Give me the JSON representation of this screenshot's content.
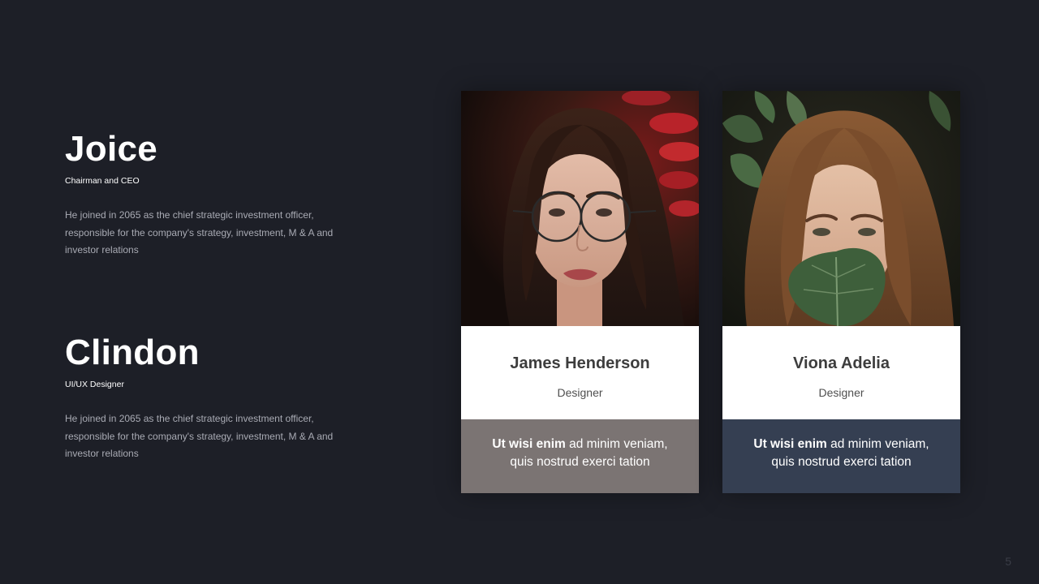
{
  "executives": [
    {
      "name": "Joice",
      "role": "Chairman and CEO",
      "bio": "He joined in 2065 as the chief strategic investment officer, responsible for the company's strategy, investment, M & A and investor relations"
    },
    {
      "name": "Clindon",
      "role": "UI/UX Designer",
      "bio": "He joined in 2065 as the chief strategic investment officer, responsible for the company's strategy, investment, M & A and investor relations"
    }
  ],
  "team": [
    {
      "name": "James Henderson",
      "role": "Designer",
      "quote_bold": "Ut wisi enim",
      "quote_rest": " ad minim veniam,",
      "quote_line2": "quis nostrud exerci tation",
      "accent": "#7b7473"
    },
    {
      "name": "Viona Adelia",
      "role": "Designer",
      "quote_bold": "Ut wisi enim",
      "quote_rest": " ad minim veniam,",
      "quote_line2": "quis nostrud exerci tation",
      "accent": "#353f52"
    }
  ],
  "page_number": "5",
  "colors": {
    "background": "#1d1f27",
    "card_white": "#ffffff",
    "bio_text": "#a9abb4"
  }
}
